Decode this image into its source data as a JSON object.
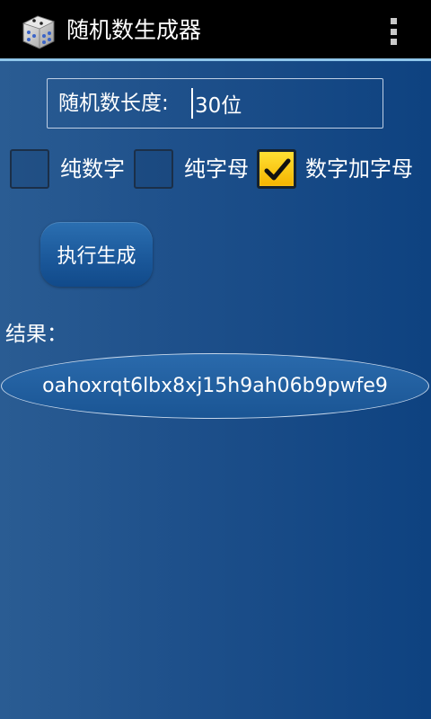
{
  "app": {
    "title": "随机数生成器",
    "icon": "dice-icon"
  },
  "action_bar": {
    "overflow_icon": "overflow-menu-icon"
  },
  "length_field": {
    "label": "随机数长度:",
    "value": "30位"
  },
  "options": [
    {
      "label": "纯数字",
      "checked": false
    },
    {
      "label": "纯字母",
      "checked": false
    },
    {
      "label": "数字加字母",
      "checked": true
    }
  ],
  "generate_button": {
    "label": "执行生成"
  },
  "result": {
    "label": "结果：",
    "value": "oahoxrqt6lbx8xj15h9ah06b9pwfe9"
  },
  "colors": {
    "action_bar": "#000000",
    "action_bar_divider": "#8fc6ea",
    "background": "#1d4f8a",
    "checkbox_checked": "#ffcc00"
  }
}
